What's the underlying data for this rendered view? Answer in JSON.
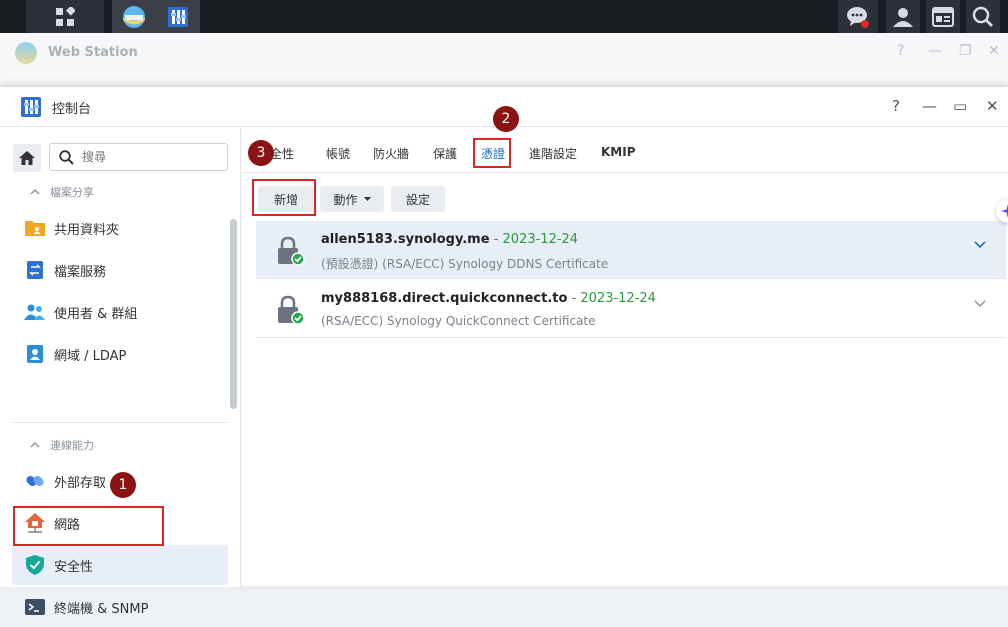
{
  "taskbar": {
    "apps_icon": "grid-icon",
    "open_apps": [
      "web-station-icon",
      "control-panel-icon"
    ],
    "right_icons": [
      "chat-icon",
      "user-icon",
      "widget-icon",
      "search-icon"
    ]
  },
  "background_window": {
    "title": "Web Station",
    "controls": [
      "?",
      "—",
      "❐",
      "✕"
    ]
  },
  "window": {
    "title": "控制台",
    "controls": [
      "?",
      "—",
      "▭",
      "✕"
    ]
  },
  "sidebar": {
    "search_placeholder": "搜尋",
    "sections": [
      {
        "label": "檔案分享",
        "items": [
          {
            "label": "共用資料夾",
            "icon": "folder-icon"
          },
          {
            "label": "檔案服務",
            "icon": "file-services-icon"
          },
          {
            "label": "使用者 & 群組",
            "icon": "users-icon"
          },
          {
            "label": "網域 / LDAP",
            "icon": "domain-icon"
          }
        ]
      },
      {
        "label": "連線能力",
        "items": [
          {
            "label": "外部存取",
            "icon": "external-access-icon"
          },
          {
            "label": "網路",
            "icon": "network-icon"
          },
          {
            "label": "安全性",
            "icon": "shield-icon",
            "active": true
          },
          {
            "label": "終端機 & SNMP",
            "icon": "terminal-icon"
          }
        ]
      }
    ]
  },
  "tabs": [
    {
      "label": "安全性"
    },
    {
      "label": "帳號"
    },
    {
      "label": "防火牆"
    },
    {
      "label": "保護"
    },
    {
      "label": "憑證",
      "active": true
    },
    {
      "label": "進階設定"
    },
    {
      "label": "KMIP"
    }
  ],
  "toolbar": {
    "add_label": "新增",
    "action_label": "動作",
    "settings_label": "設定"
  },
  "certificates": [
    {
      "name": "allen5183.synology.me",
      "separator": " - ",
      "date": "2023-12-24",
      "description": "(預設憑證) (RSA/ECC) Synology DDNS Certificate",
      "selected": true
    },
    {
      "name": "my888168.direct.quickconnect.to",
      "separator": " - ",
      "date": "2023-12-24",
      "description": "(RSA/ECC) Synology QuickConnect Certificate",
      "selected": false
    }
  ],
  "annotations": [
    "1",
    "2",
    "3"
  ],
  "colors": {
    "accent": "#1e6ec8",
    "date_green": "#2a9a3c",
    "annotation_red": "#d42a2a",
    "annotation_badge": "#8a1414",
    "selected_row": "#e7eef7"
  }
}
